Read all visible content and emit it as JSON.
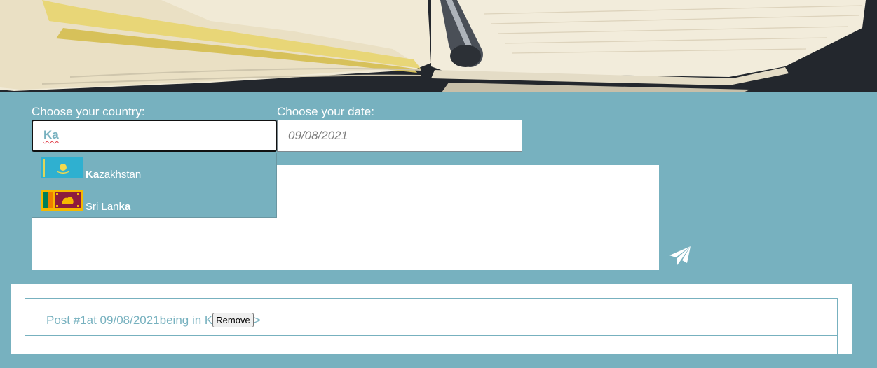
{
  "form": {
    "country_label": "Choose your country:",
    "country_value": "Ka",
    "date_label": "Choose your date:",
    "date_placeholder": "09/08/2021"
  },
  "autocomplete": {
    "items": [
      {
        "match": "Ka",
        "rest": "zakhstan",
        "flag_icon": "kazakhstan-flag-icon"
      },
      {
        "prefix": "Sri Lan",
        "match": "ka",
        "flag_icon": "sri-lanka-flag-icon"
      }
    ]
  },
  "send_icon": "paper-plane-icon",
  "posts": [
    {
      "title": "Post #1",
      "date_text": "at 09/08/2021",
      "place_text": "being in K",
      "remove_label": "Remove",
      "trailing": ">"
    }
  ],
  "colors": {
    "accent": "#77b1bf",
    "background": "#77b1bf"
  }
}
